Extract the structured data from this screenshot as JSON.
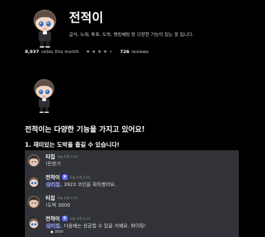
{
  "bot": {
    "name": "전적이",
    "description": "급식, 노래, 투표, 도박, 랭킹체팅 등 다양한 기능이 있는 봇 입니다.",
    "votes": "8,937",
    "votes_suffix": "votes this month",
    "rating": 4,
    "rating_max": 5,
    "reviews_count": "726",
    "reviews_label": "reviews"
  },
  "content": {
    "headline": "전적이는 다양한 기능을 가지고 있어요!",
    "section1_title": "1. 재미있는 도박을 즐길 수 있습니다!"
  },
  "chat": {
    "messages": [
      {
        "author": "티칩",
        "time": "오늘 오후 4:14",
        "text": "!돈받기"
      },
      {
        "author": "전적이",
        "badge": "봇",
        "time": "오늘 오후 4:14",
        "mention": "@티칩",
        "text": ", 3923 코인을 획득했어요."
      },
      {
        "author": "티칩",
        "time": "오늘 오후 4:14",
        "text": "!도박 3000"
      },
      {
        "author": "전적이",
        "badge": "봇",
        "time": "오늘 오후 4:14",
        "mention": "@티칩",
        "text": ", 다음에는 성공할 수 있을 거예요. 화이팅!",
        "reaction": "3000"
      }
    ]
  },
  "colors": {
    "background": "#000000",
    "chat_background": "#313338",
    "bot_badge": "#5865f2",
    "mention_background": "#3c4270"
  }
}
